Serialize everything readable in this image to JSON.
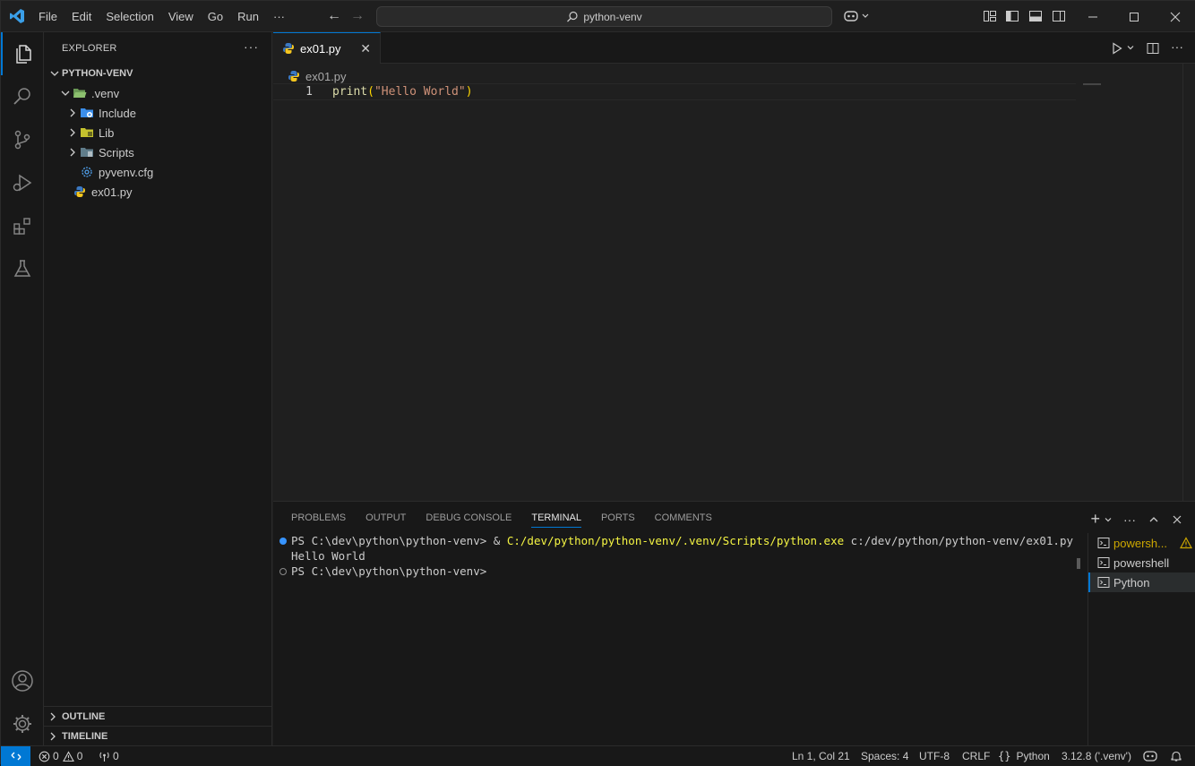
{
  "titlebar": {
    "menu": [
      "File",
      "Edit",
      "Selection",
      "View",
      "Go",
      "Run",
      "···"
    ],
    "search_text": "python-venv"
  },
  "sidebar": {
    "header": "EXPLORER",
    "more": "···",
    "root": "PYTHON-VENV",
    "tree": [
      {
        "label": ".venv",
        "icon": "folder-open-venv-icon"
      },
      {
        "label": "Include",
        "icon": "folder-include-icon"
      },
      {
        "label": "Lib",
        "icon": "folder-lib-icon"
      },
      {
        "label": "Scripts",
        "icon": "folder-scripts-icon"
      },
      {
        "label": "pyvenv.cfg",
        "icon": "gear-file-icon"
      },
      {
        "label": "ex01.py",
        "icon": "python-file-icon"
      }
    ],
    "outline": "OUTLINE",
    "timeline": "TIMELINE"
  },
  "editor": {
    "tab_label": "ex01.py",
    "breadcrumb": "ex01.py",
    "line_number": "1",
    "code": {
      "fn": "print",
      "open": "(",
      "str": "\"Hello World\"",
      "close": ")"
    }
  },
  "panel": {
    "tabs": [
      "PROBLEMS",
      "OUTPUT",
      "DEBUG CONSOLE",
      "TERMINAL",
      "PORTS",
      "COMMENTS"
    ],
    "active_tab": "TERMINAL",
    "terminal": {
      "prompt1": "PS C:\\dev\\python\\python-venv> ",
      "amp": "& ",
      "exe": "C:/dev/python/python-venv/.venv/Scripts/python.exe",
      "arg": " c:/dev/python/python-venv/ex01.py",
      "output": "Hello World",
      "prompt2": "PS C:\\dev\\python\\python-venv>"
    },
    "terminals": [
      "powersh...",
      "powershell",
      "Python"
    ]
  },
  "status": {
    "errors": "0",
    "warnings": "0",
    "ports": "0",
    "position": "Ln 1, Col 21",
    "spaces": "Spaces: 4",
    "encoding": "UTF-8",
    "eol": "CRLF",
    "language": "Python",
    "interpreter": "3.12.8 ('.venv')"
  },
  "colors": {
    "accent": "#0078d4",
    "function": "#dcdcaa",
    "string": "#ce9178",
    "bracket": "#ffd700",
    "warning": "#cca700"
  }
}
